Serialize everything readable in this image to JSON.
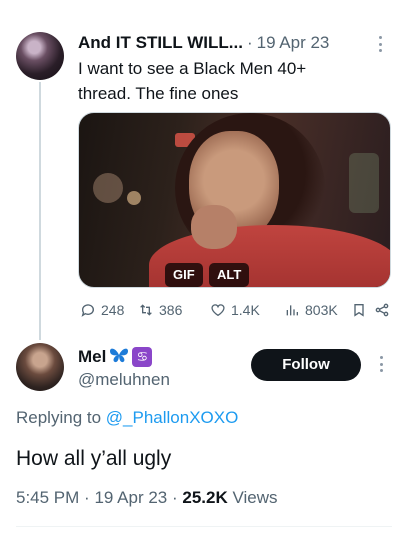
{
  "parent_tweet": {
    "display_name": "And IT STILL WILL...",
    "separator": "·",
    "date": "19 Apr 23",
    "text_line1": "I want to see a Black Men 40+",
    "text_line2": "thread. The fine ones",
    "media": {
      "badges": [
        "GIF",
        "ALT"
      ]
    },
    "actions": {
      "replies": "248",
      "retweets": "386",
      "likes": "1.4K",
      "views": "803K"
    }
  },
  "tweet": {
    "display_name": "Mel",
    "handle": "@meluhnen",
    "follow_label": "Follow",
    "replying_prefix": "Replying to",
    "replying_to": "@_PhallonXOXO",
    "text": "How all y’all ugly",
    "time": "5:45 PM",
    "date": "19 Apr 23",
    "views_count": "25.2K",
    "views_label": "Views",
    "separator": "·"
  },
  "icons": {
    "emoji_butterfly": "butterfly-icon",
    "zodiac": "cancer-sign-icon",
    "zodiac_glyph": "♋"
  },
  "colors": {
    "link": "#1d9bf0",
    "secondary_text": "#536471",
    "follow_bg": "#0f1419",
    "zodiac_bg": "#8a46c9"
  }
}
